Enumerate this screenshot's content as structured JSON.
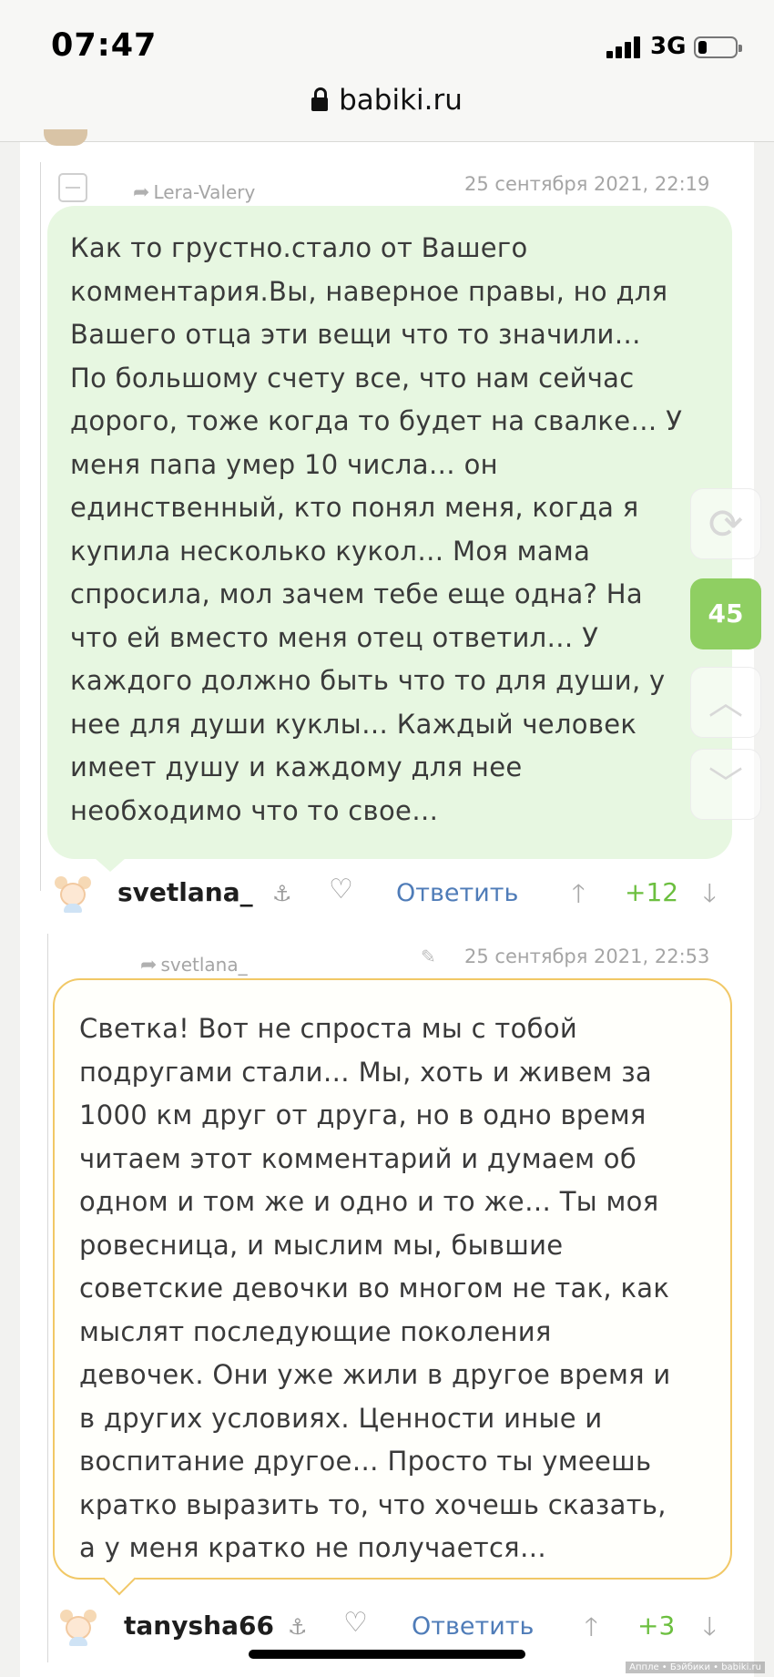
{
  "status_bar": {
    "time": "07:47",
    "network": "3G",
    "battery_level": 0.22
  },
  "browser": {
    "url": "babiki.ru"
  },
  "comments": [
    {
      "reply_to": "Lera-Valery",
      "date": "25 сентября 2021, 22:19",
      "text": "Как то грустно.стало от Вашего комментария.Вы, наверное правы, но для Вашего отца эти вещи что то значили… По большому счету все, что нам сейчас дорого, тоже когда то будет на свалке… У меня папа умер 10 числа… он единственный, кто понял меня, когда я купила несколько кукол… Моя мама спросила, мол зачем тебе еще одна? На что ей вместо меня отец ответил… У каждого должно быть что то для души, у нее для души куклы… Каждый человек имеет душу и каждому для нее необходимо что то свое…",
      "lines": [
        "Как то грустно.стало от Вашего",
        "комментария.Вы, наверное правы, но для",
        "Вашего отца эти вещи что то значили…",
        "По большому счету все, что нам сейчас",
        "дорого, тоже когда то будет на свалке… У",
        "меня папа умер 10 числа… он",
        "единственный, кто понял меня, когда я",
        "купила несколько кукол… Моя мама",
        "спросила, мол зачем тебе еще одна? На",
        "что ей вместо меня отец ответил… У",
        "каждого должно быть что то для души, у",
        "нее для души куклы… Каждый человек",
        "имеет душу и каждому для нее",
        "необходимо что то свое…"
      ],
      "author": "svetlana_",
      "reply_label": "Ответить",
      "score": "+12"
    },
    {
      "reply_to": "svetlana_",
      "date": "25 сентября 2021, 22:53",
      "lines": [
        "Светка! Вот не спроста мы с тобой",
        "подругами стали… Мы, хоть и живем за",
        "1000 км друг от друга, но в одно время",
        "читаем этот комментарий и думаем об",
        "одном и том же и одно и то же… Ты моя",
        "ровесница, и мыслим мы, бывшие",
        "советские девочки во многом не так, как",
        "мыслят последующие поколения",
        "девочек. Они уже жили в другое время и",
        "в других условиях. Ценности иные и",
        "воспитание другое… Просто ты умеешь",
        "кратко выразить то, что хочешь сказать,",
        "а у меня кратко не получается…"
      ],
      "author": "tanysha66",
      "reply_label": "Ответить",
      "score": "+3"
    }
  ],
  "side_controls": {
    "comment_count": "45"
  },
  "watermark": "Аппле • Бэйбики • babiki.ru"
}
